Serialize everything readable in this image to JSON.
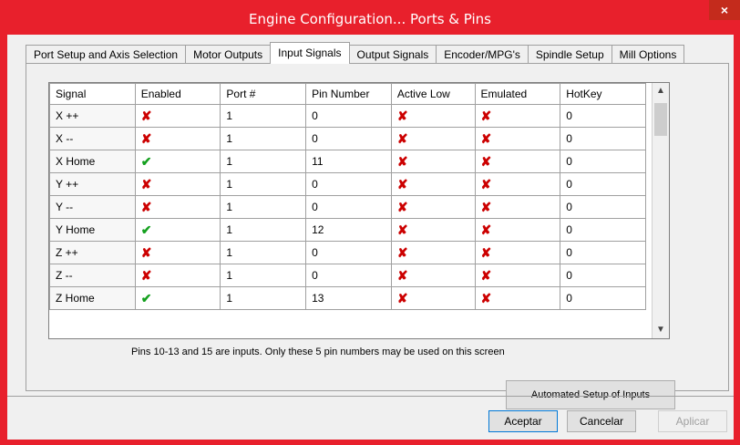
{
  "window": {
    "title": "Engine Configuration... Ports & Pins",
    "close_label": "×"
  },
  "tabs": [
    {
      "label": "Port Setup and Axis Selection"
    },
    {
      "label": "Motor Outputs"
    },
    {
      "label": "Input Signals"
    },
    {
      "label": "Output Signals"
    },
    {
      "label": "Encoder/MPG's"
    },
    {
      "label": "Spindle Setup"
    },
    {
      "label": "Mill Options"
    }
  ],
  "grid": {
    "columns": [
      "Signal",
      "Enabled",
      "Port #",
      "Pin Number",
      "Active Low",
      "Emulated",
      "HotKey"
    ],
    "rows": [
      {
        "signal": "X ++",
        "enabled": "x",
        "port": "1",
        "pin": "0",
        "active_low": "x",
        "emulated": "x",
        "hotkey": "0"
      },
      {
        "signal": "X --",
        "enabled": "x",
        "port": "1",
        "pin": "0",
        "active_low": "x",
        "emulated": "x",
        "hotkey": "0"
      },
      {
        "signal": "X Home",
        "enabled": "check",
        "port": "1",
        "pin": "11",
        "active_low": "x",
        "emulated": "x",
        "hotkey": "0"
      },
      {
        "signal": "Y ++",
        "enabled": "x",
        "port": "1",
        "pin": "0",
        "active_low": "x",
        "emulated": "x",
        "hotkey": "0"
      },
      {
        "signal": "Y --",
        "enabled": "x",
        "port": "1",
        "pin": "0",
        "active_low": "x",
        "emulated": "x",
        "hotkey": "0"
      },
      {
        "signal": "Y Home",
        "enabled": "check",
        "port": "1",
        "pin": "12",
        "active_low": "x",
        "emulated": "x",
        "hotkey": "0"
      },
      {
        "signal": "Z ++",
        "enabled": "x",
        "port": "1",
        "pin": "0",
        "active_low": "x",
        "emulated": "x",
        "hotkey": "0"
      },
      {
        "signal": "Z --",
        "enabled": "x",
        "port": "1",
        "pin": "0",
        "active_low": "x",
        "emulated": "x",
        "hotkey": "0"
      },
      {
        "signal": "Z Home",
        "enabled": "check",
        "port": "1",
        "pin": "13",
        "active_low": "x",
        "emulated": "x",
        "hotkey": "0"
      }
    ]
  },
  "note": "Pins 10-13 and 15 are inputs. Only these 5 pin numbers may be used on this screen",
  "automated_button": "Automated Setup of Inputs",
  "buttons": {
    "accept": "Aceptar",
    "cancel": "Cancelar",
    "apply": "Aplicar"
  },
  "colors": {
    "title_bar": "#e8202c",
    "x_mark": "#cc0000",
    "check_mark": "#14a01e"
  }
}
